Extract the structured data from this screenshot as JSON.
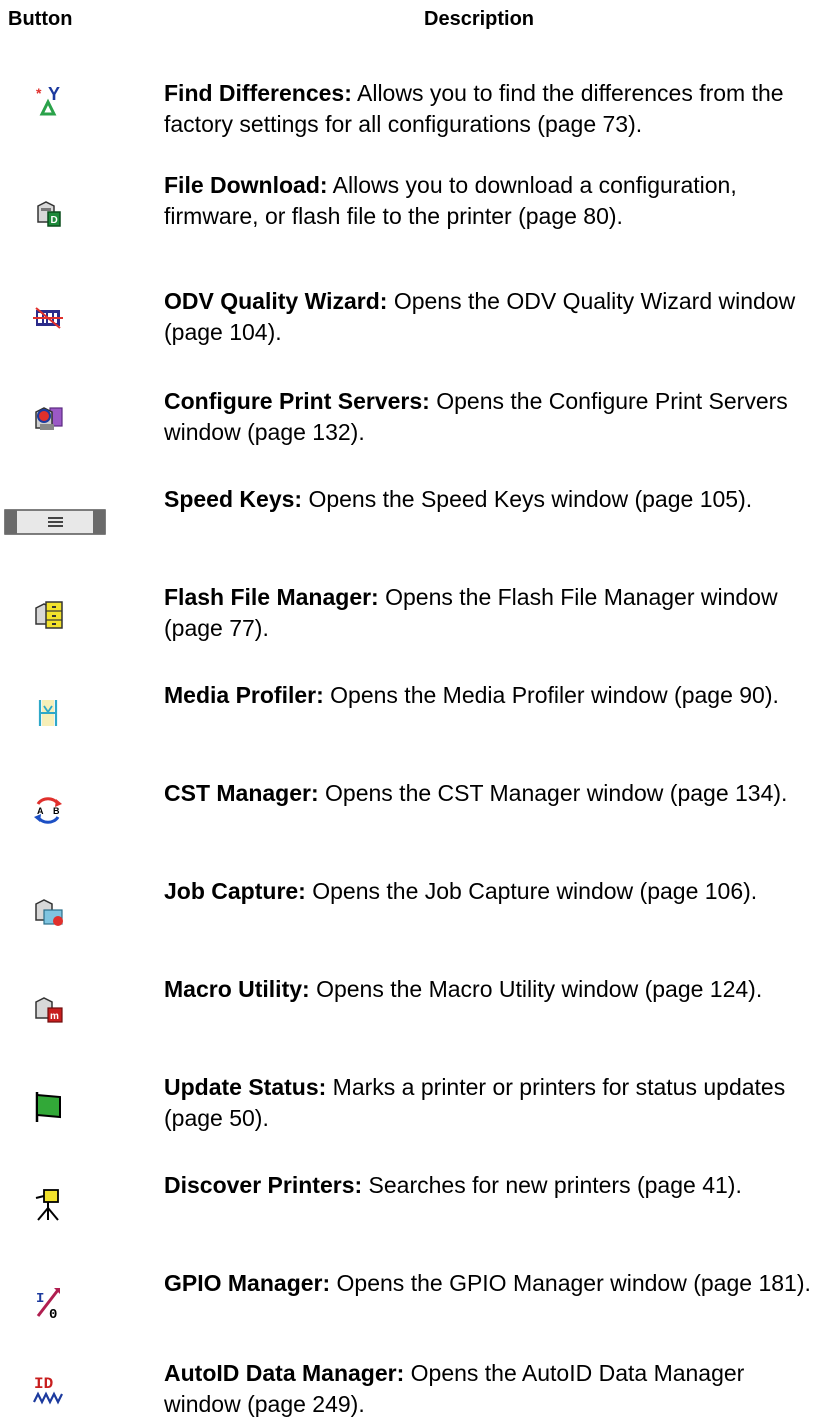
{
  "header": {
    "button_label": "Button",
    "description_label": "Description"
  },
  "rows": [
    {
      "icon": "find-differences-icon",
      "title": "Find Differences:",
      "text": " Allows you to find the differences from the factory settings for all configurations (page 73)."
    },
    {
      "icon": "file-download-icon",
      "title": "File Download:",
      "text": " Allows you to download a configuration, firmware, or flash file to the printer (page 80)."
    },
    {
      "icon": "odv-quality-wizard-icon",
      "title": "ODV Quality Wizard:",
      "text": " Opens the ODV Quality Wizard window (page 104)."
    },
    {
      "icon": "configure-print-servers-icon",
      "title": "Configure Print Servers:",
      "text": " Opens the Configure Print Servers window (page 132)."
    },
    {
      "icon": "speed-keys-icon",
      "title": "Speed Keys:",
      "text": " Opens the Speed Keys window (page 105)."
    },
    {
      "icon": "flash-file-manager-icon",
      "title": "Flash File Manager:",
      "text": " Opens the Flash File Manager window (page 77)."
    },
    {
      "icon": "media-profiler-icon",
      "title": "Media Profiler:",
      "text": " Opens the Media Profiler window (page 90)."
    },
    {
      "icon": "cst-manager-icon",
      "title": "CST Manager:",
      "text": " Opens the CST Manager window (page 134)."
    },
    {
      "icon": "job-capture-icon",
      "title": "Job Capture:",
      "text": " Opens the Job Capture window (page 106)."
    },
    {
      "icon": "macro-utility-icon",
      "title": "Macro Utility:",
      "text": " Opens the Macro Utility window (page 124)."
    },
    {
      "icon": "update-status-icon",
      "title": "Update Status:",
      "text": " Marks a printer or printers for status updates (page 50)."
    },
    {
      "icon": "discover-printers-icon",
      "title": "Discover Printers:",
      "text": " Searches for new printers (page 41)."
    },
    {
      "icon": "gpio-manager-icon",
      "title": "GPIO Manager:",
      "text": " Opens the GPIO Manager window (page 181)."
    },
    {
      "icon": "autoid-data-manager-icon",
      "title": "AutoID Data Manager:",
      "text": " Opens the AutoID Data Manager window (page 249)."
    }
  ]
}
